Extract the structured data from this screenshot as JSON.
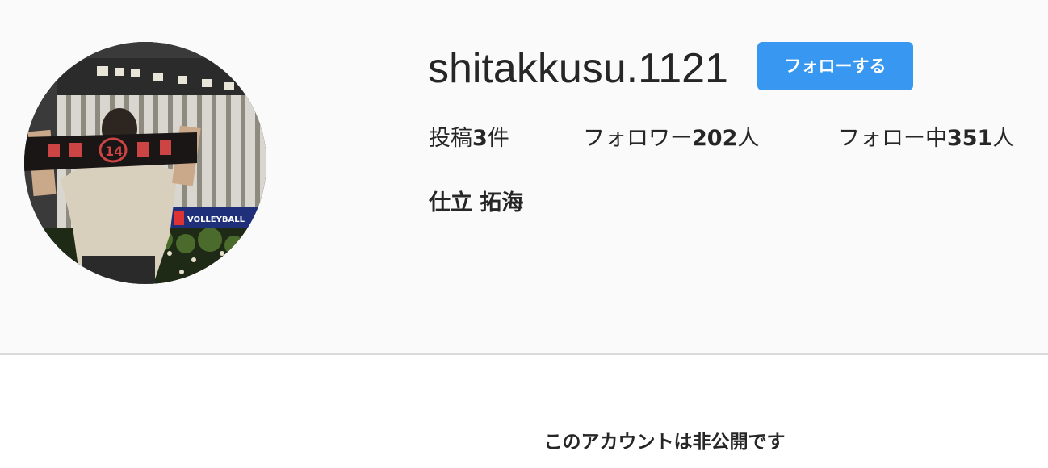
{
  "profile": {
    "username": "shitakkusu.1121",
    "follow_button_label": "フォローする",
    "full_name": "仕立 拓海",
    "stats": {
      "posts_prefix": "投稿",
      "posts_count": "3",
      "posts_suffix": "件",
      "followers_prefix": "フォロワー",
      "followers_count": "202",
      "followers_suffix": "人",
      "following_prefix": "フォロー中",
      "following_count": "351",
      "following_suffix": "人"
    },
    "avatar_sign_text": "VOLLEYBALL",
    "avatar_banner_text": "14"
  },
  "private_notice": "このアカウントは非公開です",
  "colors": {
    "header_bg": "#fafafa",
    "follow_button": "#3897f0",
    "text": "#262626",
    "divider": "#dbdbdb"
  }
}
